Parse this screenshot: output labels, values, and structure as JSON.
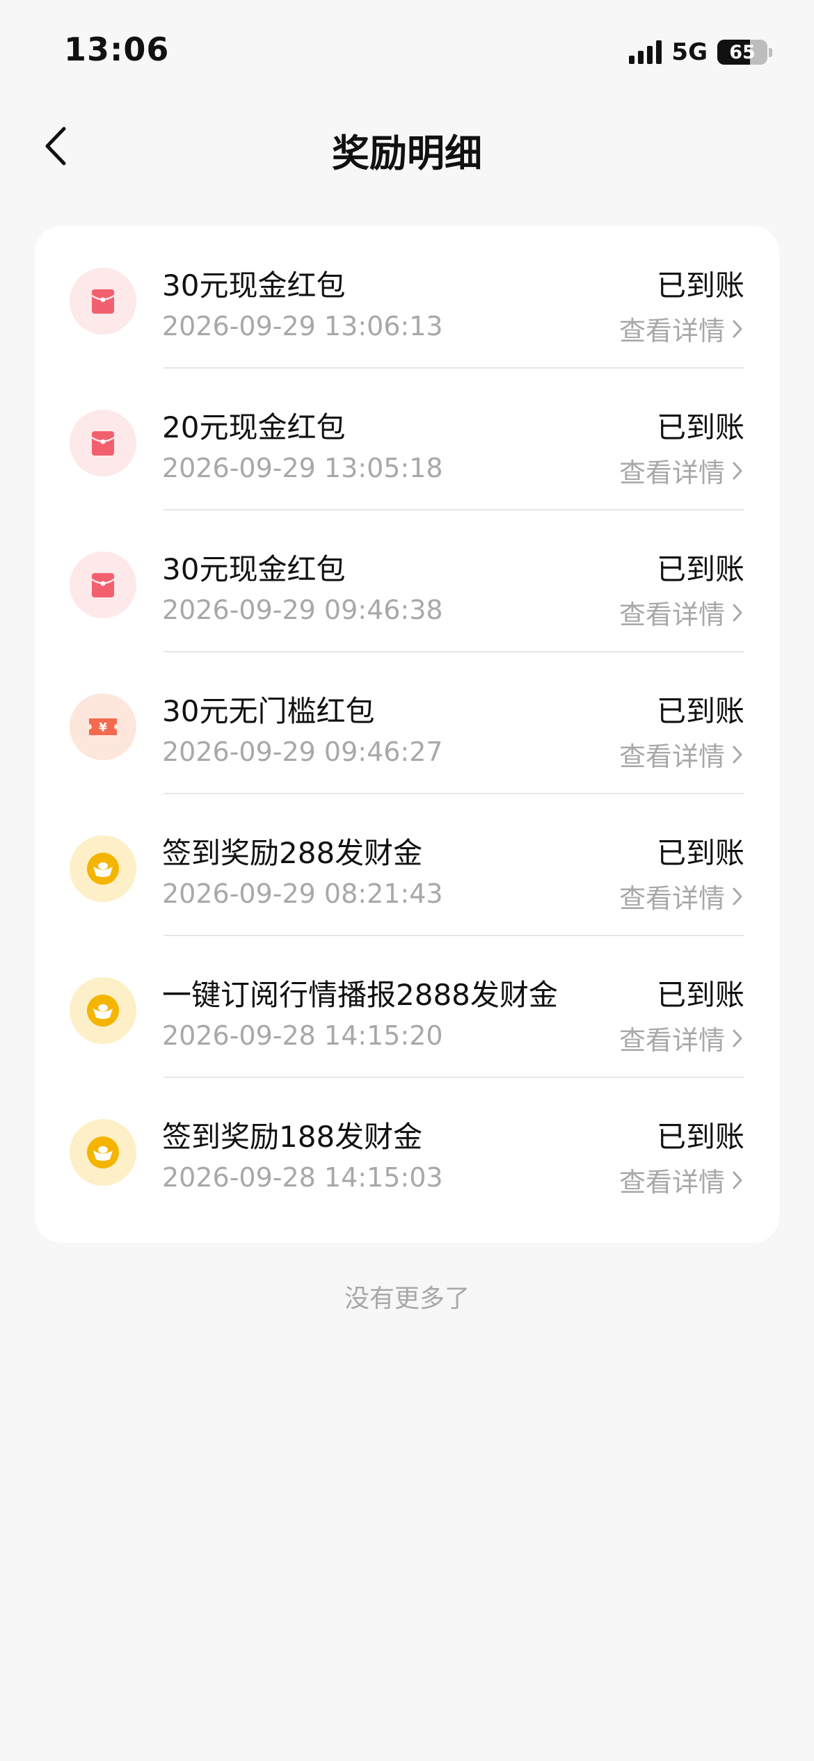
{
  "status_bar": {
    "time": "13:06",
    "network": "5G",
    "battery": "65",
    "battery_level": 0.65
  },
  "header": {
    "title": "奖励明细",
    "back_icon": "chevron-left-icon"
  },
  "rewards": [
    {
      "title": "30元现金红包",
      "time": "2026-09-29 13:06:13",
      "status": "已到账",
      "detail": "查看详情",
      "icon": "red-envelope-icon"
    },
    {
      "title": "20元现金红包",
      "time": "2026-09-29 13:05:18",
      "status": "已到账",
      "detail": "查看详情",
      "icon": "red-envelope-icon"
    },
    {
      "title": "30元现金红包",
      "time": "2026-09-29 09:46:38",
      "status": "已到账",
      "detail": "查看详情",
      "icon": "red-envelope-icon"
    },
    {
      "title": "30元无门槛红包",
      "time": "2026-09-29 09:46:27",
      "status": "已到账",
      "detail": "查看详情",
      "icon": "yuan-coupon-icon"
    },
    {
      "title": "签到奖励288发财金",
      "time": "2026-09-29 08:21:43",
      "status": "已到账",
      "detail": "查看详情",
      "icon": "gold-ingot-icon"
    },
    {
      "title": "一键订阅行情播报2888发财金",
      "time": "2026-09-28 14:15:20",
      "status": "已到账",
      "detail": "查看详情",
      "icon": "gold-ingot-icon"
    },
    {
      "title": "签到奖励188发财金",
      "time": "2026-09-28 14:15:03",
      "status": "已到账",
      "detail": "查看详情",
      "icon": "gold-ingot-icon"
    }
  ],
  "footer": {
    "note": "没有更多了"
  },
  "colors": {
    "background": "#f7f7f7",
    "card": "#ffffff",
    "red_icon_bg": "#fde8ea",
    "red_icon": "#f2606f",
    "coupon_icon_bg": "#fde6dc",
    "coupon_icon": "#f36a4f",
    "gold_icon_bg": "#fdf0c8",
    "gold_icon": "#f5b400",
    "secondary_text": "#a8a8a8"
  }
}
